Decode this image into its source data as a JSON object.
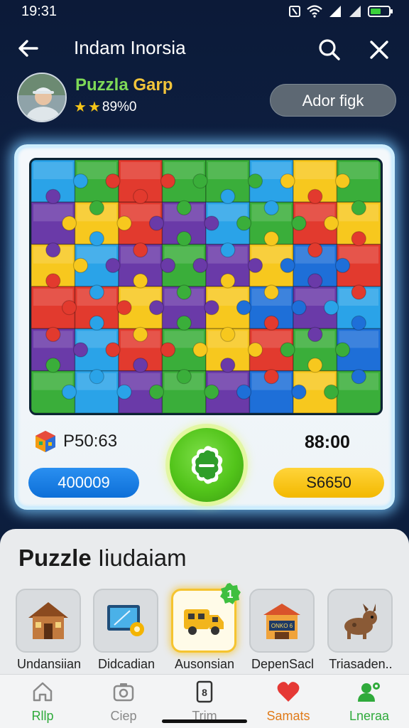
{
  "status_bar": {
    "time": "19:31"
  },
  "header": {
    "title": "Indam Inorsia"
  },
  "player": {
    "name_part1": "Puzzla",
    "name_part2": "Garp",
    "rating_text": "89%0",
    "action_label": "Ador figk"
  },
  "game": {
    "stat_left": "P50:63",
    "stat_right": "88:00",
    "button_left": "400009",
    "button_right": "S6650"
  },
  "sheet": {
    "title_bold": "Puzzle",
    "title_rest": "Iiudaiam",
    "levels": [
      {
        "label": "Undansiian",
        "icon": "house-icon"
      },
      {
        "label": "Didcadian",
        "icon": "picture-frame-icon"
      },
      {
        "label": "Ausonsian",
        "icon": "truck-icon",
        "badge": "1"
      },
      {
        "label": "DepenSacl",
        "icon": "shop-icon",
        "sign": "ONKO 6"
      },
      {
        "label": "Triasaden..",
        "icon": "dog-icon"
      }
    ]
  },
  "nav": [
    {
      "label": "Rllp",
      "icon": "home-icon",
      "color": "#2faa3b"
    },
    {
      "label": "Ciep",
      "icon": "camera-icon",
      "color": "#8a8a8a"
    },
    {
      "label": "Trim",
      "icon": "phone-8-icon",
      "color": "#8a8a8a"
    },
    {
      "label": "Samats",
      "icon": "heart-icon",
      "color": "#e07b1a"
    },
    {
      "label": "Lneraa",
      "icon": "user-add-icon",
      "color": "#2faa3b"
    }
  ],
  "colors": {
    "accent_green": "#52c41a",
    "blue_pill": "#0d6fd8",
    "yellow_pill": "#f3b800",
    "background": "#0c1a38"
  }
}
